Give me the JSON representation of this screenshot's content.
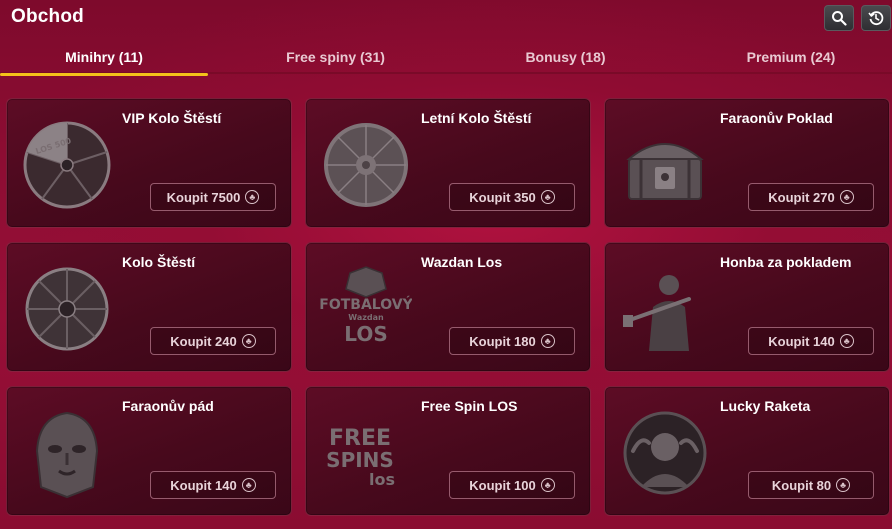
{
  "header": {
    "title": "Obchod",
    "search_icon": "search-icon",
    "history_icon": "history-icon"
  },
  "tabs": [
    {
      "label": "Minihry (11)",
      "active": true
    },
    {
      "label": "Free spiny (31)",
      "active": false
    },
    {
      "label": "Bonusy (18)",
      "active": false
    },
    {
      "label": "Premium (24)",
      "active": false
    }
  ],
  "colors": {
    "accent": "#f4c21a",
    "background": "#8d0d33",
    "card": "#47091c"
  },
  "items": [
    {
      "name": "VIP Kolo Štěstí",
      "buy_label": "Koupit 7500",
      "icon": "vip-wheel-icon",
      "wheel_text": "LOS 500"
    },
    {
      "name": "Letní Kolo Štěstí",
      "buy_label": "Koupit 350",
      "icon": "summer-wheel-icon"
    },
    {
      "name": "Faraonův Poklad",
      "buy_label": "Koupit 270",
      "icon": "treasure-chest-icon"
    },
    {
      "name": "Kolo Štěstí",
      "buy_label": "Koupit 240",
      "icon": "wheel-icon"
    },
    {
      "name": "Wazdan Los",
      "buy_label": "Koupit 180",
      "icon": "football-ticket-icon",
      "logo_line1": "FOTBALOVÝ",
      "logo_line2": "Wazdan",
      "logo_line3": "LOS"
    },
    {
      "name": "Honba za pokladem",
      "buy_label": "Koupit 140",
      "icon": "treasure-hunter-icon"
    },
    {
      "name": "Faraonův pád",
      "buy_label": "Koupit 140",
      "icon": "pharaoh-mask-icon"
    },
    {
      "name": "Free Spin LOS",
      "buy_label": "Koupit 100",
      "icon": "free-spins-icon",
      "logo_line1": "FREE",
      "logo_line2": "SPINS",
      "logo_line3": "los"
    },
    {
      "name": "Lucky Raketa",
      "buy_label": "Koupit 80",
      "icon": "lucky-rocket-icon"
    }
  ],
  "currency_icon": "clover-coin-icon"
}
